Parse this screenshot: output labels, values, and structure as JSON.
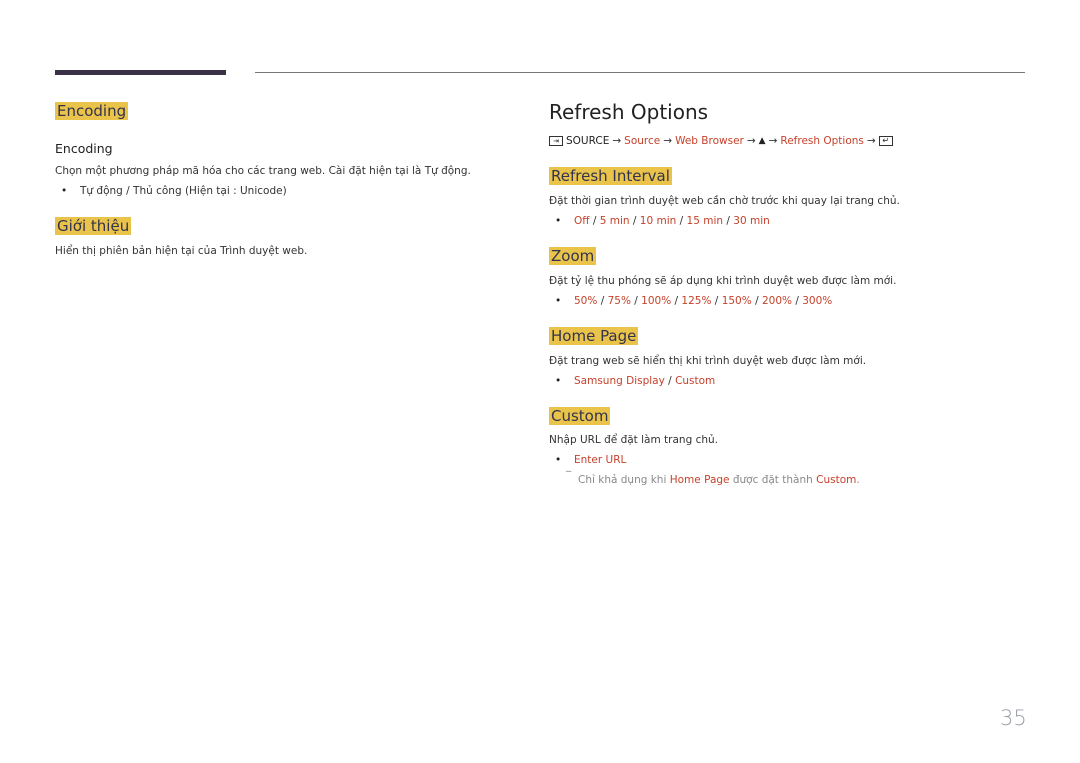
{
  "left": {
    "encoding_section": {
      "heading": "Encoding",
      "subheading": "Encoding",
      "description": "Chọn một phương pháp mã hóa cho các trang web. Cài đặt hiện tại là Tự động.",
      "bullet": "Tự động / Thủ công (Hiện tại : Unicode)"
    },
    "about_section": {
      "heading": "Giới thiệu",
      "description": "Hiển thị phiên bản hiện tại của Trình duyệt web."
    }
  },
  "right": {
    "title": "Refresh Options",
    "nav_path": {
      "source_icon": "source-icon",
      "source_label": "SOURCE",
      "arrow": "→",
      "step1": "Source",
      "step2": "Web Browser",
      "up_icon": "▲",
      "step3": "Refresh Options",
      "enter_icon": "enter-icon"
    },
    "refresh_interval": {
      "heading": "Refresh Interval",
      "description": "Đặt thời gian trình duyệt web cần chờ trước khi quay lại trang chủ.",
      "options": [
        "Off",
        "5 min",
        "10 min",
        "15 min",
        "30 min"
      ]
    },
    "zoom": {
      "heading": "Zoom",
      "description": "Đặt tỷ lệ thu phóng sẽ áp dụng khi trình duyệt web được làm mới.",
      "options": [
        "50%",
        "75%",
        "100%",
        "125%",
        "150%",
        "200%",
        "300%"
      ]
    },
    "home_page": {
      "heading": "Home Page",
      "description": "Đặt trang web sẽ hiển thị khi trình duyệt web được làm mới.",
      "options": [
        "Samsung Display",
        "Custom"
      ]
    },
    "custom": {
      "heading": "Custom",
      "description": "Nhập URL để đặt làm trang chủ.",
      "option": "Enter URL",
      "note": {
        "prefix": "Chỉ khả dụng khi",
        "ref1": "Home Page",
        "middle": "được đặt thành",
        "ref2": "Custom",
        "suffix": "."
      }
    }
  },
  "separator": "/",
  "page_number": "35",
  "colors": {
    "highlight": "#e9c34a",
    "accent_red": "#c5412a",
    "top_bar": "#3c3248",
    "page_number": "#9a9ca8"
  }
}
